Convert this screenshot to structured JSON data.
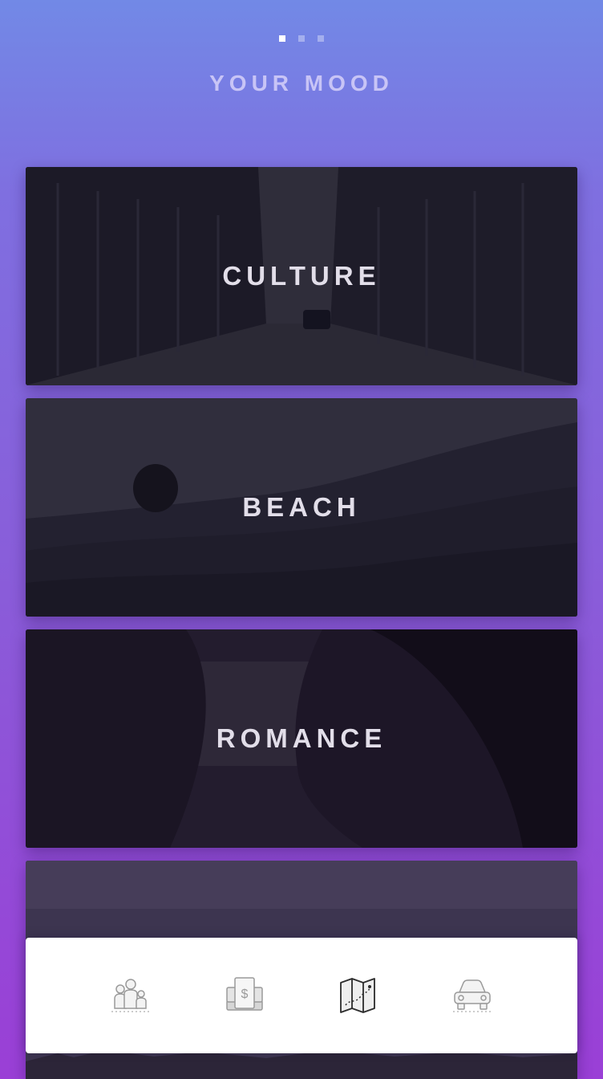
{
  "pager": {
    "count": 3,
    "active_index": 0
  },
  "header": {
    "title": "YOUR MOOD"
  },
  "moods": [
    {
      "label": "CULTURE"
    },
    {
      "label": "BEACH"
    },
    {
      "label": "ROMANCE"
    },
    {
      "label": ""
    }
  ],
  "bottom_nav": {
    "items": [
      {
        "icon": "family-icon"
      },
      {
        "icon": "money-icon"
      },
      {
        "icon": "map-icon",
        "active": true
      },
      {
        "icon": "car-icon"
      }
    ]
  },
  "colors": {
    "background_top": "#7289e6",
    "background_bottom": "#9a3fd6",
    "label_text": "#e2dee9"
  }
}
